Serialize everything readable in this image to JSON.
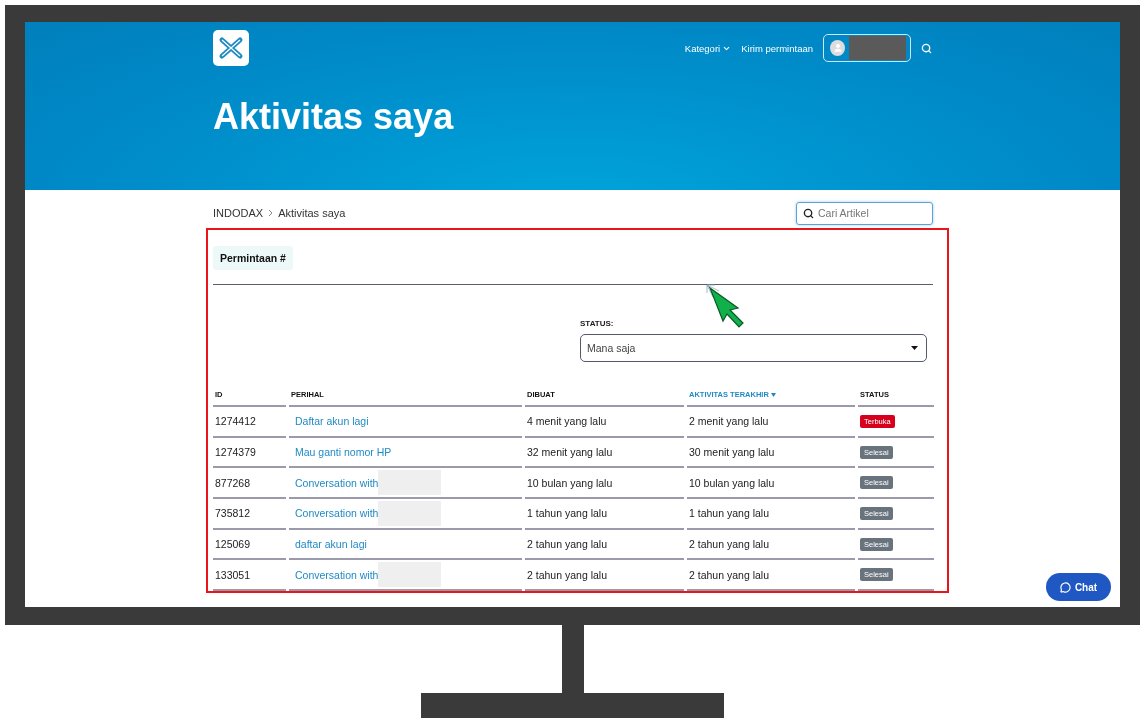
{
  "header": {
    "nav": [
      {
        "label": "Kategori",
        "kind": "dropdown"
      },
      {
        "label": "Kirim permintaan",
        "kind": "link"
      }
    ]
  },
  "title": "Aktivitas saya",
  "breadcrumb": [
    "INDODAX",
    "Aktivitas saya"
  ],
  "search": {
    "placeholder": "Cari Artikel"
  },
  "tabs": [
    {
      "label": "Permintaan #",
      "selected": true
    }
  ],
  "filter": {
    "label": "STATUS:",
    "value": "Mana saja"
  },
  "table": {
    "columns": [
      {
        "label": "ID",
        "sorted": false
      },
      {
        "label": "PERIHAL",
        "sorted": false
      },
      {
        "label": "DIBUAT",
        "sorted": false
      },
      {
        "label": "AKTIVITAS TERAKHIR",
        "sorted": true
      },
      {
        "label": "STATUS",
        "sorted": false
      }
    ],
    "rows": [
      {
        "id": "1274412",
        "subject": "Daftar akun lagi",
        "redacted": false,
        "created": "4 menit yang lalu",
        "updated": "2 menit yang lalu",
        "status": {
          "label": "Terbuka",
          "kind": "open"
        }
      },
      {
        "id": "1274379",
        "subject": "Mau ganti nomor HP",
        "redacted": false,
        "created": "32 menit yang lalu",
        "updated": "30 menit yang lalu",
        "status": {
          "label": "Selesai",
          "kind": "solved"
        }
      },
      {
        "id": "877268",
        "subject": "Conversation with",
        "redacted": true,
        "created": "10 bulan yang lalu",
        "updated": "10 bulan yang lalu",
        "status": {
          "label": "Selesai",
          "kind": "solved"
        }
      },
      {
        "id": "735812",
        "subject": "Conversation with",
        "redacted": true,
        "created": "1 tahun yang lalu",
        "updated": "1 tahun yang lalu",
        "status": {
          "label": "Selesai",
          "kind": "solved"
        }
      },
      {
        "id": "125069",
        "subject": "daftar akun lagi",
        "redacted": false,
        "created": "2 tahun yang lalu",
        "updated": "2 tahun yang lalu",
        "status": {
          "label": "Selesai",
          "kind": "solved"
        }
      },
      {
        "id": "133051",
        "subject": "Conversation with",
        "redacted": true,
        "created": "2 tahun yang lalu",
        "updated": "2 tahun yang lalu",
        "status": {
          "label": "Selesai",
          "kind": "solved"
        }
      }
    ]
  },
  "chat": {
    "label": "Chat"
  }
}
